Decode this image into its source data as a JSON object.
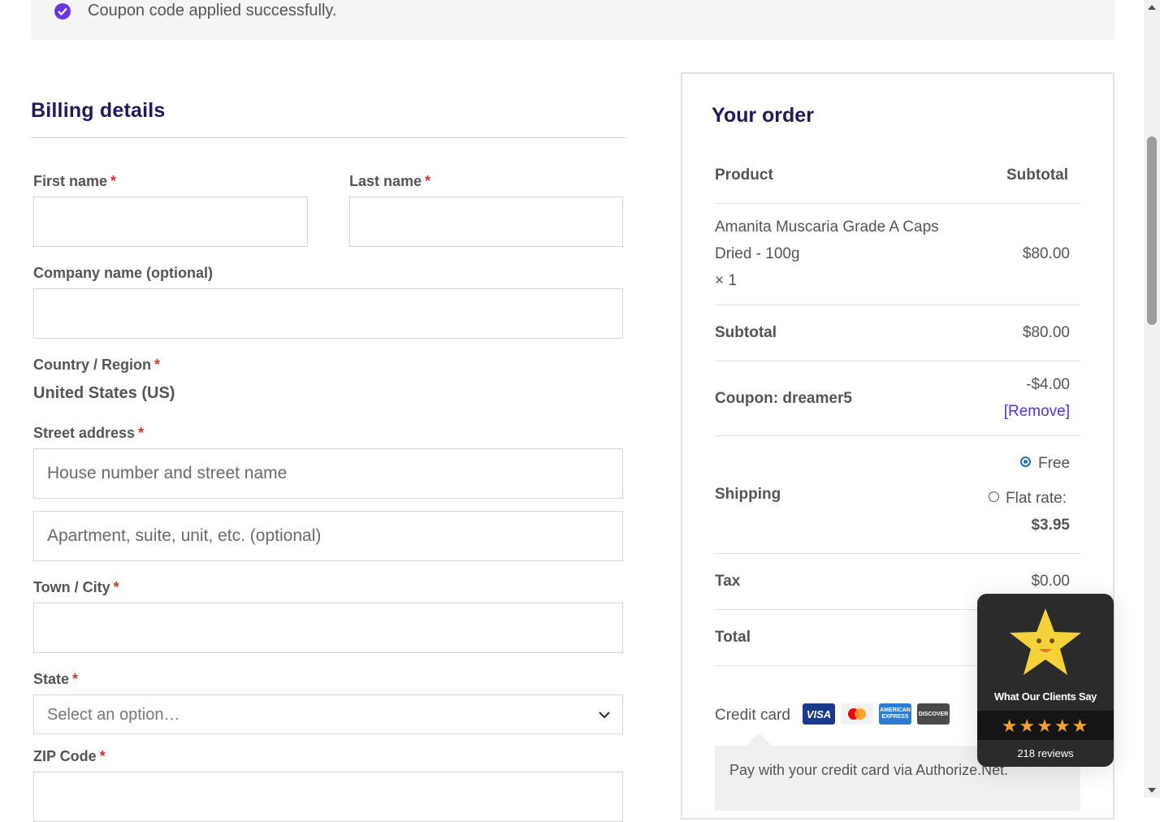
{
  "notice": {
    "message": "Coupon code applied successfully."
  },
  "billing": {
    "title": "Billing details",
    "first_name_label": "First name",
    "last_name_label": "Last name",
    "company_label": "Company name (optional)",
    "country_label": "Country / Region",
    "country_value": "United States (US)",
    "street_label": "Street address",
    "street1_placeholder": "House number and street name",
    "street2_placeholder": "Apartment, suite, unit, etc. (optional)",
    "city_label": "Town / City",
    "state_label": "State",
    "state_placeholder": "Select an option…",
    "zip_label": "ZIP Code",
    "required_mark": "*"
  },
  "order": {
    "title": "Your order",
    "col_product": "Product",
    "col_subtotal": "Subtotal",
    "item_name_line1": "Amanita Muscaria Grade A Caps",
    "item_name_line2": "Dried - 100g",
    "item_qty": "× 1",
    "item_price": "$80.00",
    "subtotal_label": "Subtotal",
    "subtotal_value": "$80.00",
    "coupon_label": "Coupon: dreamer5",
    "coupon_value": "-$4.00",
    "coupon_remove": "[Remove]",
    "shipping_label": "Shipping",
    "shipping_free": "Free",
    "shipping_flat_label": "Flat rate:",
    "shipping_flat_value": "$3.95",
    "tax_label": "Tax",
    "tax_value": "$0.00",
    "total_label": "Total",
    "payment_label": "Credit card",
    "cards": [
      "VISA",
      "mastercard",
      "AMERICAN EXPRESS",
      "DISCOVER"
    ],
    "payment_note": "Pay with your credit card via Authorize.Net."
  },
  "widget": {
    "title": "What Our Clients Say",
    "rating_stars": "★★★★★",
    "reviews": "218 reviews"
  },
  "colors": {
    "accent": "#6a38e0",
    "heading": "#1f1a5c",
    "required": "#d0342c",
    "link": "#5b2fd6",
    "star": "#f3a22d"
  }
}
